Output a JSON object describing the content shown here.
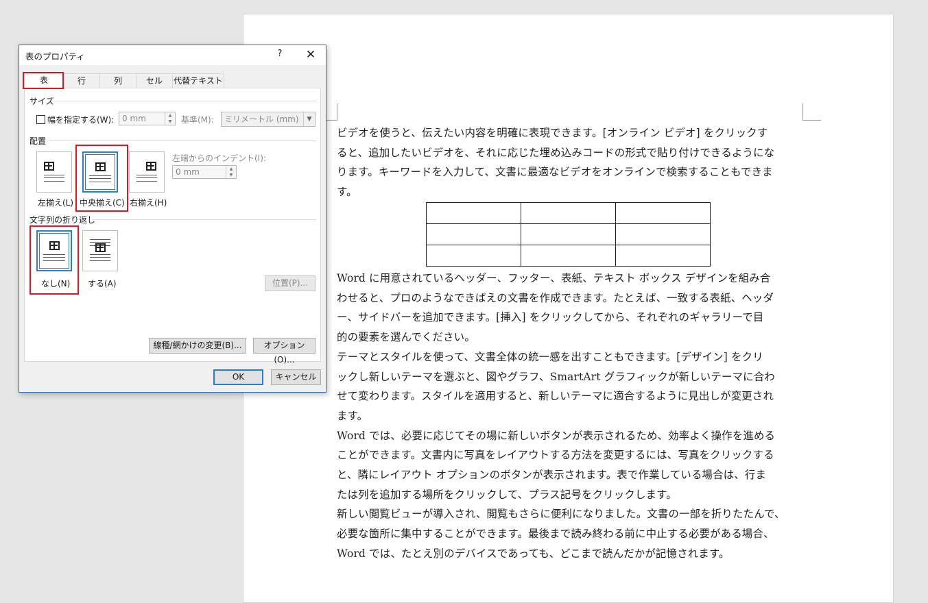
{
  "document": {
    "paragraph1": "ビデオを使うと、伝えたい内容を明確に表現できます。[オンライン ビデオ] をクリックす\nると、追加したいビデオを、それに応じた埋め込みコードの形式で貼り付けできるようにな\nります。キーワードを入力して、文書に最適なビデオをオンラインで検索することもできま\nす。",
    "paragraph2": "Word に用意されているヘッダー、フッター、表紙、テキスト ボックス デザインを組み合\nわせると、プロのようなできばえの文書を作成できます。たとえば、一致する表紙、ヘッダ\nー、サイドバーを追加できます。[挿入] をクリックしてから、それぞれのギャラリーで目\n的の要素を選んでください。\nテーマとスタイルを使って、文書全体の統一感を出すこともできます。[デザイン] をクリ\nックし新しいテーマを選ぶと、図やグラフ、SmartArt グラフィックが新しいテーマに合わ\nせて変わります。スタイルを適用すると、新しいテーマに適合するように見出しが変更され\nます。\nWord では、必要に応じてその場に新しいボタンが表示されるため、効率よく操作を進める\nことができます。文書内に写真をレイアウトする方法を変更するには、写真をクリックする\nと、隣にレイアウト オプションのボタンが表示されます。表で作業している場合は、行ま\nたは列を追加する場所をクリックして、プラス記号をクリックします。\n新しい閲覧ビューが導入され、閲覧もさらに便利になりました。文書の一部を折りたたんで、\n必要な箇所に集中することができます。最後まで読み終わる前に中止する必要がある場合、\nWord では、たとえ別のデバイスであっても、どこまで読んだかが記憶されます。",
    "table": {
      "rows": 3,
      "cols": 3
    }
  },
  "dialog": {
    "title": "表のプロパティ",
    "help": "?",
    "close": "✕",
    "tabs": [
      "表",
      "行",
      "列",
      "セル",
      "代替テキスト"
    ],
    "active_tab": "表",
    "size": {
      "label": "サイズ",
      "width_checkbox_label": "幅を指定する(W):",
      "width_value": "0 mm",
      "basis_label": "基準(M):",
      "basis_value": "ミリメートル (mm)"
    },
    "alignment": {
      "label": "配置",
      "options": [
        "左揃え(L)",
        "中央揃え(C)",
        "右揃え(H)"
      ],
      "selected": "中央揃え(C)",
      "indent_label": "左端からのインデント(I):",
      "indent_value": "0 mm"
    },
    "text_wrapping": {
      "label": "文字列の折り返し",
      "options": [
        "なし(N)",
        "する(A)"
      ],
      "selected": "なし(N)",
      "position_button": "位置(P)..."
    },
    "borders_button": "線種/網かけの変更(B)...",
    "options_button": "オプション(O)...",
    "ok_button": "OK",
    "cancel_button": "キャンセル"
  },
  "colors": {
    "highlight": "#e0141e",
    "selection": "#2b7fc9",
    "dialog_border": "#2b6cb5"
  }
}
